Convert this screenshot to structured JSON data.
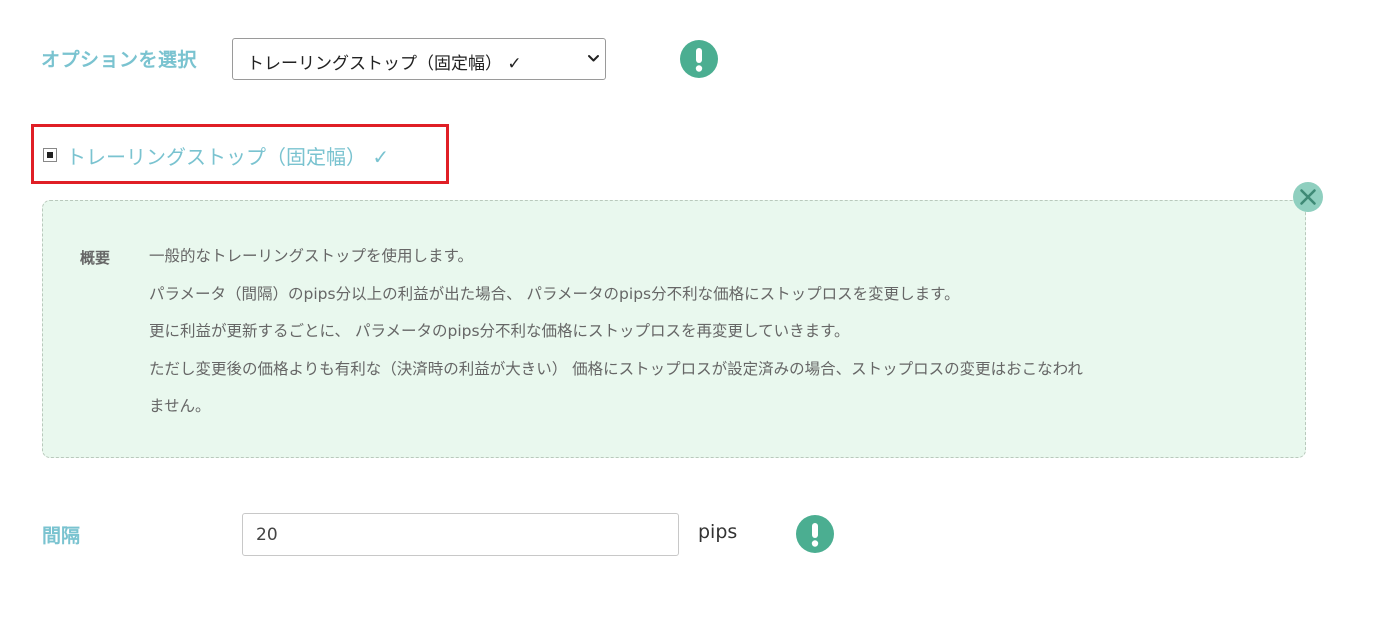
{
  "option_select": {
    "label": "オプションを選択",
    "selected_value": "トレーリングストップ（固定幅） ✓"
  },
  "checkbox_option": {
    "label": "トレーリングストップ（固定幅） ✓",
    "checked": true
  },
  "description": {
    "heading": "概要",
    "lines": [
      "一般的なトレーリングストップを使用します。",
      "パラメータ（間隔）のpips分以上の利益が出た場合、 パラメータのpips分不利な価格にストップロスを変更します。",
      "更に利益が更新するごとに、 パラメータのpips分不利な価格にストップロスを再変更していきます。",
      "ただし変更後の価格よりも有利な（決済時の利益が大きい） 価格にストップロスが設定済みの場合、ストップロスの変更はおこなわれ",
      "ません。"
    ]
  },
  "interval": {
    "label": "間隔",
    "value": "20",
    "unit": "pips"
  },
  "icons": {
    "alert": "exclamation-circle-icon",
    "close": "close-circle-icon",
    "dropdown": "chevron-down-icon"
  },
  "colors": {
    "label_teal": "#7ac3d0",
    "alert_green": "#4bae91",
    "panel_bg": "#e9f8ee",
    "highlight_red": "#e01f26"
  }
}
